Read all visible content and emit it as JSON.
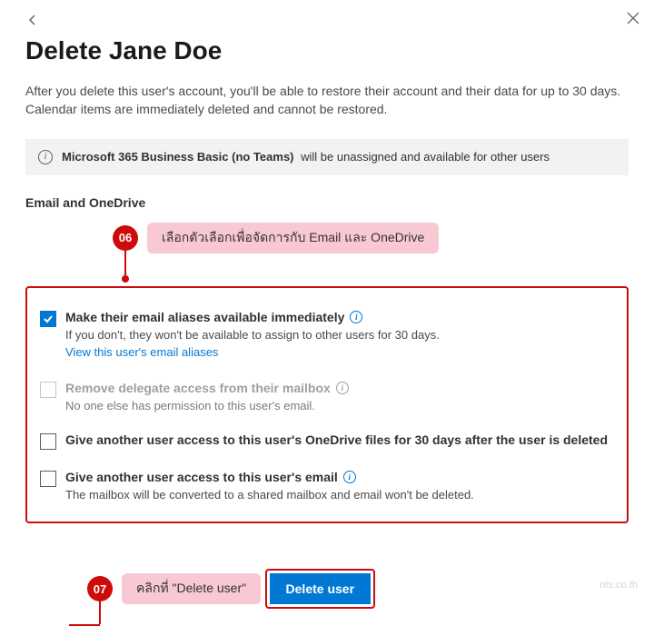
{
  "header": {
    "title": "Delete Jane Doe"
  },
  "lead_text": "After you delete this user's account, you'll be able to restore their account and their data for up to 30 days. Calendar items are immediately deleted and cannot be restored.",
  "banner": {
    "bold": "Microsoft 365 Business Basic (no Teams)",
    "rest": "will be unassigned and available for other users"
  },
  "section_label": "Email and OneDrive",
  "callouts": {
    "top": {
      "num": "06",
      "text": "เลือกตัวเลือกเพื่อจัดการกับ Email และ OneDrive"
    },
    "bottom": {
      "num": "07",
      "text": "คลิกที่ \"Delete user\""
    }
  },
  "options": {
    "aliases": {
      "title": "Make their email aliases available immediately",
      "sub": "If you don't, they won't be available to assign to other users for 30 days.",
      "link": "View this user's email aliases"
    },
    "delegate": {
      "title": "Remove delegate access from their mailbox",
      "sub": "No one else has permission to this user's email."
    },
    "onedrive": {
      "title": "Give another user access to this user's OneDrive files for 30 days after the user is deleted"
    },
    "email": {
      "title": "Give another user access to this user's email",
      "sub": "The mailbox will be converted to a shared mailbox and email won't be deleted."
    }
  },
  "actions": {
    "delete": "Delete user"
  },
  "watermark": "nts.co.th"
}
